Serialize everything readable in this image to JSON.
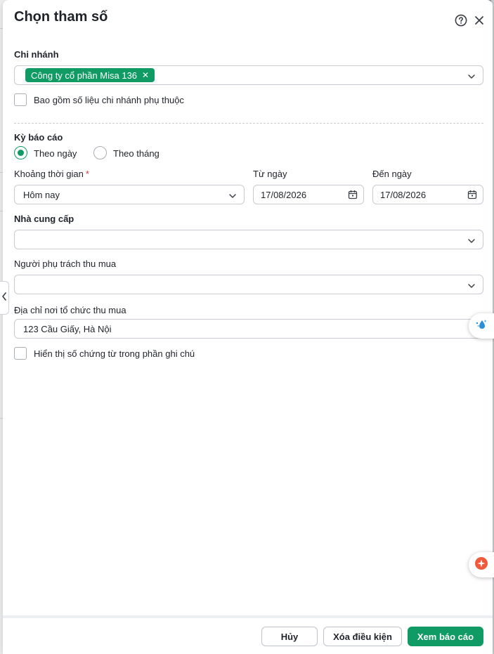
{
  "dialog": {
    "title": "Chọn tham số"
  },
  "branch": {
    "label": "Chi nhánh",
    "selected_tag": "Công ty cổ phần Misa 136",
    "include_dependent_label": "Bao gồm số liệu chi nhánh phụ thuộc",
    "include_dependent_checked": false
  },
  "period": {
    "label": "Kỳ báo cáo",
    "options": [
      "Theo ngày",
      "Theo tháng"
    ],
    "selected": "Theo ngày"
  },
  "time_range": {
    "label": "Khoảng thời gian",
    "required_mark": "*",
    "value": "Hôm nay"
  },
  "from_date": {
    "label": "Từ ngày",
    "value": "17/08/2026"
  },
  "to_date": {
    "label": "Đến ngày",
    "value": "17/08/2026"
  },
  "supplier": {
    "label": "Nhà cung cấp",
    "value": ""
  },
  "purchaser": {
    "label": "Người phụ trách thu mua",
    "value": ""
  },
  "address": {
    "label": "Địa chỉ nơi tổ chức thu mua",
    "value": "123 Cầu Giấy, Hà Nội"
  },
  "show_voucher": {
    "label": "Hiển thị số chứng từ trong phần ghi chú",
    "checked": false
  },
  "footer": {
    "cancel_label": "Hủy",
    "clear_label": "Xóa điều kiện",
    "view_label": "Xem báo cáo"
  },
  "colors": {
    "primary": "#0f9b63",
    "required": "#e5393a",
    "ai_assist": "#f05a3c",
    "drop_icon": "#2a8fd8"
  },
  "icons": [
    "help-icon",
    "close-icon",
    "chevron-down-icon",
    "calendar-icon",
    "chevron-left-icon",
    "sparkle-drop-icon",
    "ai-assist-icon"
  ]
}
